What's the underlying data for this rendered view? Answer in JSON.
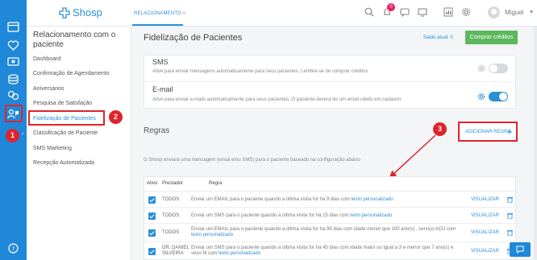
{
  "header": {
    "logo_text": "Shosp",
    "active_tab": "RELACIONAMENTO",
    "tab_close": "×",
    "notification_badge": "0",
    "user_name": "Miguel",
    "user_chevron": "▼"
  },
  "iconbar": {
    "icons": [
      "menu-icon",
      "heart-icon",
      "monitor-icon",
      "calendar-icon",
      "database-icon",
      "finance-icon",
      "relationship-icon",
      "help-icon"
    ]
  },
  "sidebar": {
    "title": "Relacionamento com o paciente",
    "caret": "›",
    "items": [
      {
        "label": "Dashboard"
      },
      {
        "label": "Confirmação de Agendamento"
      },
      {
        "label": "Aniversários"
      },
      {
        "label": "Pesquisa de Satisfação"
      },
      {
        "label": "Fidelização de Pacientes"
      },
      {
        "label": "Classificação de Paciente"
      },
      {
        "label": "SMS Marketing"
      },
      {
        "label": "Recepção Automatizada"
      }
    ]
  },
  "callouts": {
    "one": "1",
    "two": "2",
    "three": "3"
  },
  "main": {
    "title": "Fidelização de Pacientes",
    "saldo": "Saldo atual: 0",
    "buy_button": "Comprar créditos",
    "sms": {
      "title": "SMS",
      "desc": "Ative para enviar mensagens automaticamente para seus pacientes. Lembre-se de comprar créditos",
      "enabled": false
    },
    "email": {
      "title": "E-mail",
      "desc": "Ative para enviar e-mails automaticamente para seus pacientes. O paciente deverá ter um email válido em cadastro",
      "enabled": true
    },
    "rules_title": "Regras",
    "add_rule": "ADICIONAR REGRA",
    "add_rule_icon": "⊕",
    "intro": "O Shosp enviará uma mensagem (email e/ou SMS) para o paciente baseado na configuração abaixo",
    "table": {
      "headers": {
        "ativo": "Ativo",
        "prestador": "Prestador",
        "regra": "Regra"
      },
      "rows": [
        {
          "prestador": "TODOS",
          "text": "Enviar um EMAIL para o paciente quando a última visita for há 9 dias com ",
          "link": "texto personalizado",
          "action": "VISUALIZAR"
        },
        {
          "prestador": "TODOS",
          "text": "Enviar um SMS para o paciente quando a última visita for há 15 dias com ",
          "link": "texto personalizado",
          "action": "VISUALIZAR"
        },
        {
          "prestador": "TODOS",
          "text": "Enviar um EMAIL para o paciente quando a última visita for há 99 dias com idade menor que 100 ano(s) , serviço ACU com ",
          "link": "texto personalizado",
          "action": "VISUALIZAR"
        },
        {
          "prestador": "DR. DANIEL SILVEIRA",
          "text": "Enviar um SMS para o paciente quando a última visita for há 45 dias com idade maior ou igual a 3 e menor que 7 ano(s) e sexo M com ",
          "link": "texto personalizado",
          "action": "VISUALIZAR"
        }
      ]
    }
  },
  "colors": {
    "primary": "#1f88d9",
    "accent": "#2c8fd6",
    "success": "#5cb85c",
    "callout": "#e0232b",
    "badge": "#e91e63"
  }
}
